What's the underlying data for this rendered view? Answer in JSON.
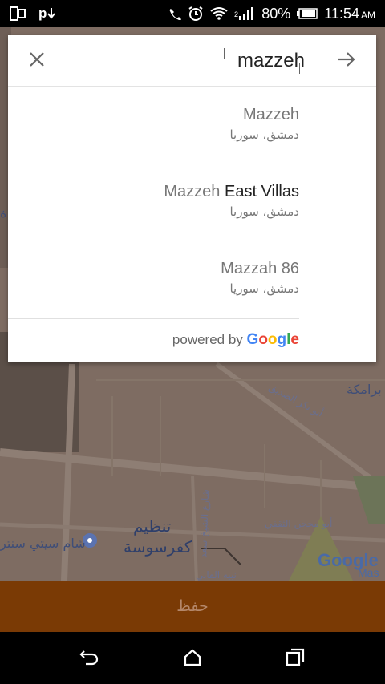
{
  "status_bar": {
    "battery": "80%",
    "time": "11:54",
    "ampm": "AM",
    "icons": [
      "screen-icon",
      "p-download-icon",
      "call-icon",
      "alarm-icon",
      "wifi-icon",
      "signal-icon",
      "battery-icon"
    ]
  },
  "search": {
    "value": "mazzeh",
    "close_icon": "close-icon",
    "go_icon": "arrow-right-icon"
  },
  "results": [
    {
      "match": "Mazzeh",
      "rest": "",
      "subtitle": "دمشق، سوريا"
    },
    {
      "match": "Mazzeh",
      "rest": " East Villas",
      "subtitle": "دمشق، سوريا"
    },
    {
      "match": "Mazzah 86",
      "rest": "",
      "subtitle": "دمشق، سوريا"
    }
  ],
  "attribution": {
    "powered_by": "powered by",
    "google": "Google"
  },
  "map": {
    "labels": [
      "برامكة",
      "أبو بكر الصديق",
      "أبو محجن الثقفي",
      "تنظيم",
      "كفرسوسة",
      "شام سيتي سنتر",
      "نبيه القابي",
      "شارع الشيخ سعد",
      "ة"
    ],
    "logo": "Google",
    "logo_suffix": "Mas"
  },
  "save_button": {
    "label": "حفظ"
  },
  "nav": {
    "back_icon": "back-icon",
    "home_icon": "home-icon",
    "recent_icon": "recent-apps-icon"
  }
}
